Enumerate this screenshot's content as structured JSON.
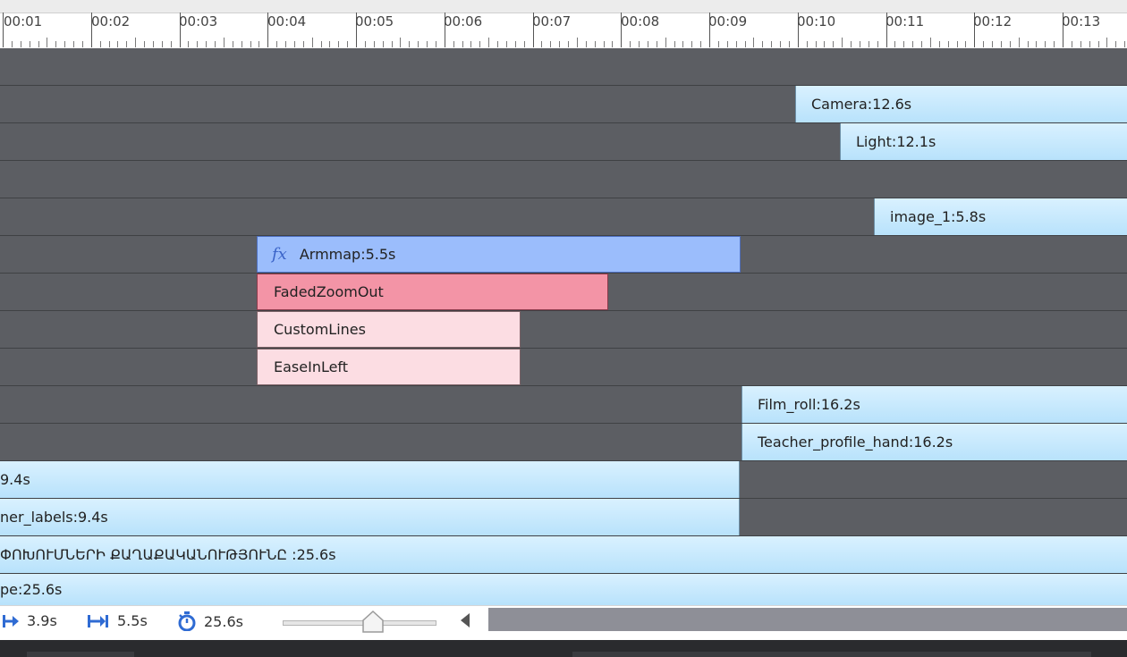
{
  "ruler": {
    "ticks": [
      "00:01",
      "00:02",
      "00:03",
      "00:04",
      "00:05",
      "00:06",
      "00:07",
      "00:08",
      "00:09",
      "00:10",
      "00:11",
      "00:12",
      "00:13"
    ]
  },
  "tracks": [
    {
      "clip": null
    },
    {
      "clip": {
        "label": "Camera:12.6s",
        "kind": "blue"
      }
    },
    {
      "clip": {
        "label": "Light:12.1s",
        "kind": "blue"
      }
    },
    {
      "clip": null
    },
    {
      "clip": {
        "label": "image_1:5.8s",
        "kind": "blue"
      }
    },
    {
      "clip": {
        "label": "Armmap:5.5s",
        "kind": "fx"
      }
    },
    {
      "clip": {
        "label": "FadedZoomOut",
        "kind": "red"
      }
    },
    {
      "clip": {
        "label": "CustomLines",
        "kind": "pink"
      }
    },
    {
      "clip": {
        "label": "EaseInLeft",
        "kind": "pink"
      }
    },
    {
      "clip": {
        "label": "Film_roll:16.2s",
        "kind": "blue"
      }
    },
    {
      "clip": {
        "label": "Teacher_profile_hand:16.2s",
        "kind": "blue"
      }
    },
    {
      "clip": {
        "label": "9.4s",
        "kind": "blue"
      }
    },
    {
      "clip": {
        "label": "ner_labels:9.4s",
        "kind": "blue"
      }
    },
    {
      "clip": {
        "label": "ՓՈԽՈՒՄՆԵՐԻ ՔԱՂԱՔԱԿԱՆՈՒԹՅՈՒՆԸ :25.6s",
        "kind": "blue"
      }
    },
    {
      "clip": {
        "label": "pe:25.6s",
        "kind": "blue"
      }
    }
  ],
  "fx_icon_text": "fx",
  "bottom": {
    "start_time": "3.9s",
    "duration": "5.5s",
    "total": "25.6s",
    "zoom_level": 0.6
  },
  "colors": {
    "track_bg": "#5c5e63",
    "clip_blue": "#c4e8fd",
    "clip_fx": "#9bbdfc",
    "clip_red": "#f394a6",
    "clip_pink": "#fcdde3",
    "icon_blue": "#2f6bd3"
  },
  "icons": [
    "start-time-icon",
    "duration-icon",
    "stopwatch-icon",
    "scroll-left-icon"
  ]
}
